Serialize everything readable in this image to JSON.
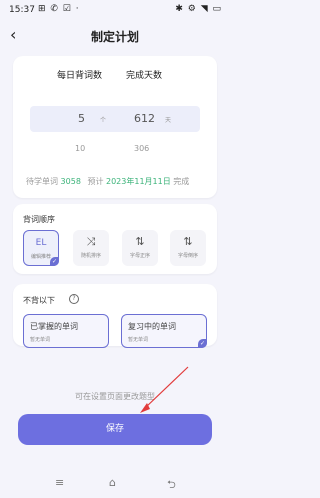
{
  "status_bar": {
    "time": "15:37",
    "left_icons": "⊞ ✆ ☑ ·",
    "right_icons": "✱ ⚙ ◥ ▭"
  },
  "header": {
    "title": "制定计划",
    "back_icon": "‹"
  },
  "plan": {
    "daily_label": "每日背词数",
    "days_label": "完成天数",
    "daily_value": "5",
    "daily_unit": "个",
    "days_value": "612",
    "days_unit": "天",
    "daily_next": "10",
    "days_next": "306",
    "pending_label": "待学单词",
    "pending_count": "3058",
    "expected_label": "预计",
    "expected_date": "2023年11月11日",
    "expected_suffix": "完成"
  },
  "order": {
    "section_title": "背词顺序",
    "options": [
      {
        "icon": "EL",
        "label": "编辑推荐",
        "selected": true
      },
      {
        "icon": "⤨",
        "label": "随机排序",
        "selected": false
      },
      {
        "icon": "⇅",
        "label": "字母正序",
        "selected": false
      },
      {
        "icon": "⇅",
        "label": "字母倒序",
        "selected": false
      }
    ]
  },
  "skip": {
    "section_title": "不背以下",
    "help_icon": "?",
    "options": [
      {
        "title": "已掌握的单词",
        "sub": "暂无单词"
      },
      {
        "title": "复习中的单词",
        "sub": "暂无单词"
      }
    ]
  },
  "footer": {
    "hint": "可在设置页面更改题型",
    "save_label": "保存"
  },
  "nav": {
    "menu": "≡",
    "home": "⌂",
    "back": "⮌"
  },
  "colors": {
    "accent": "#6d6fe0",
    "green": "#3cb37a"
  }
}
